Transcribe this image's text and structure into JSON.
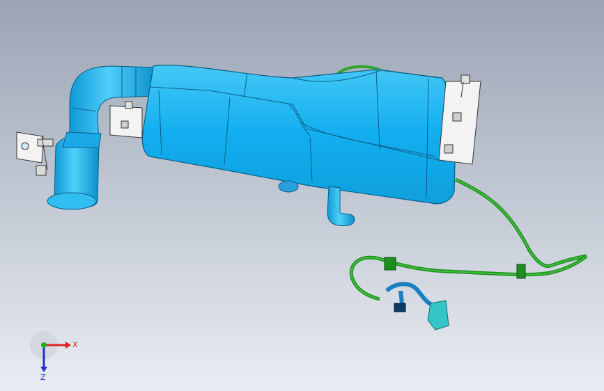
{
  "viewport": {
    "background_top": "#9aa4b4",
    "background_bottom": "#e9edf3"
  },
  "model": {
    "body_color": "#17b2ee",
    "body_edge_color": "#0a5d86",
    "hose_color": "#2fa52b",
    "bracket_color": "#f3f3f3"
  },
  "triad": {
    "x_label": "X",
    "z_label": "Z",
    "x_color": "#e02020",
    "y_color": "#1fae1f",
    "z_color": "#2432c8"
  }
}
